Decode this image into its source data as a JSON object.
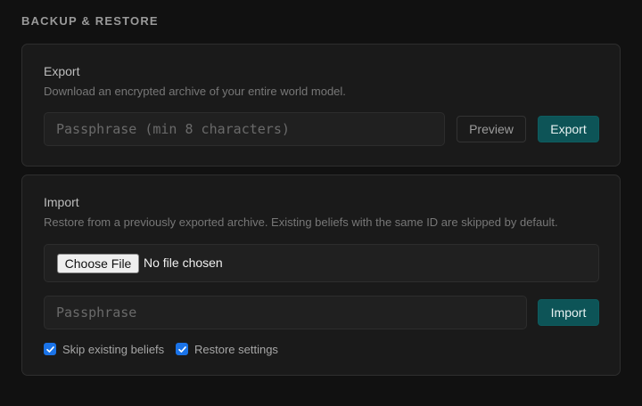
{
  "section": {
    "title": "BACKUP & RESTORE"
  },
  "export": {
    "title": "Export",
    "description": "Download an encrypted archive of your entire world model.",
    "passphrase_placeholder": "Passphrase (min 8 characters)",
    "passphrase_value": "",
    "preview_label": "Preview",
    "export_label": "Export"
  },
  "import": {
    "title": "Import",
    "description": "Restore from a previously exported archive. Existing beliefs with the same ID are skipped by default.",
    "file_button_label": "Choose File",
    "file_status": "No file chosen",
    "passphrase_placeholder": "Passphrase",
    "passphrase_value": "",
    "import_label": "Import",
    "options": [
      {
        "label": "Skip existing beliefs",
        "checked": true
      },
      {
        "label": "Restore settings",
        "checked": true
      }
    ]
  },
  "colors": {
    "accent": "#0d5457",
    "checkbox": "#1a73e8",
    "background": "#111111",
    "card": "#1a1a1a"
  },
  "icons": {
    "checkbox_mark": "checkmark-icon"
  }
}
